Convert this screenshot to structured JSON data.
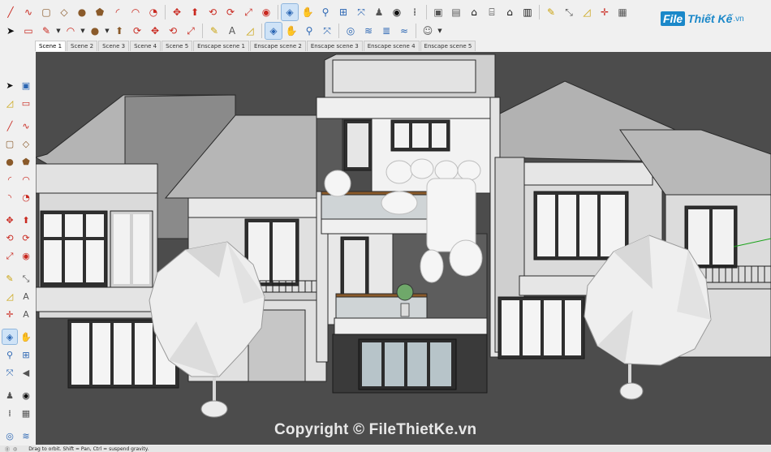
{
  "brand": {
    "badge": "File",
    "name": "Thiết Kế",
    "ext": ".vn"
  },
  "toolbar_row1": [
    {
      "name": "line-icon",
      "glyph": "╱",
      "color": "red"
    },
    {
      "name": "freehand-icon",
      "glyph": "∿",
      "color": "red"
    },
    {
      "name": "rectangle-icon",
      "glyph": "▢",
      "color": "brown"
    },
    {
      "name": "rotated-rectangle-icon",
      "glyph": "◇",
      "color": "brown"
    },
    {
      "name": "circle-icon",
      "glyph": "●",
      "color": "brown"
    },
    {
      "name": "polygon-icon",
      "glyph": "⬟",
      "color": "brown"
    },
    {
      "name": "arc-icon",
      "glyph": "◜",
      "color": "red"
    },
    {
      "name": "two-point-arc-icon",
      "glyph": "◠",
      "color": "red"
    },
    {
      "name": "pie-icon",
      "glyph": "◔",
      "color": "red"
    },
    {
      "name": "sep"
    },
    {
      "name": "move-icon",
      "glyph": "✥",
      "color": "red"
    },
    {
      "name": "push-pull-icon",
      "glyph": "⬆",
      "color": "red"
    },
    {
      "name": "rotate-icon",
      "glyph": "⟲",
      "color": "red"
    },
    {
      "name": "follow-me-icon",
      "glyph": "⟳",
      "color": "red"
    },
    {
      "name": "scale-icon",
      "glyph": "⤢",
      "color": "red"
    },
    {
      "name": "offset-icon",
      "glyph": "◉",
      "color": "red"
    },
    {
      "name": "sep"
    },
    {
      "name": "orbit-icon",
      "glyph": "◈",
      "color": "blue",
      "active": true
    },
    {
      "name": "pan-icon",
      "glyph": "✋",
      "color": "yellow"
    },
    {
      "name": "zoom-icon",
      "glyph": "⚲",
      "color": "blue"
    },
    {
      "name": "zoom-window-icon",
      "glyph": "⊞",
      "color": "blue"
    },
    {
      "name": "zoom-extents-icon",
      "glyph": "⤧",
      "color": "blue"
    },
    {
      "name": "position-camera-icon",
      "glyph": "♟",
      "color": "gray"
    },
    {
      "name": "look-around-icon",
      "glyph": "◉",
      "color": "black"
    },
    {
      "name": "walk-icon",
      "glyph": "⁞",
      "color": "black"
    },
    {
      "name": "sep"
    },
    {
      "name": "components-icon",
      "glyph": "▣",
      "color": "gray"
    },
    {
      "name": "materials-icon",
      "glyph": "▤",
      "color": "gray"
    },
    {
      "name": "home-icon",
      "glyph": "⌂",
      "color": "black"
    },
    {
      "name": "warehouse-icon",
      "glyph": "⌸",
      "color": "black"
    },
    {
      "name": "share-model-icon",
      "glyph": "⌂",
      "color": "black"
    },
    {
      "name": "extension-warehouse-icon",
      "glyph": "▥",
      "color": "black"
    },
    {
      "name": "sep"
    },
    {
      "name": "tape-measure-icon",
      "glyph": "✎",
      "color": "yellow"
    },
    {
      "name": "dimension-icon",
      "glyph": "⤡",
      "color": "gray"
    },
    {
      "name": "protractor-icon",
      "glyph": "◿",
      "color": "yellow"
    },
    {
      "name": "axes-icon",
      "glyph": "✛",
      "color": "red"
    },
    {
      "name": "section-plane-icon",
      "glyph": "▦",
      "color": "gray"
    }
  ],
  "toolbar_row2": [
    {
      "name": "select-icon",
      "glyph": "➤",
      "color": "black"
    },
    {
      "name": "eraser-icon",
      "glyph": "▭",
      "color": "red"
    },
    {
      "name": "pencil-icon",
      "glyph": "✎",
      "color": "red",
      "dropdown": true
    },
    {
      "name": "arc-tool-icon",
      "glyph": "◠",
      "color": "red",
      "dropdown": true
    },
    {
      "name": "shape-tool-icon",
      "glyph": "●",
      "color": "brown",
      "dropdown": true
    },
    {
      "name": "push-pull-tool-icon",
      "glyph": "⬆",
      "color": "brown"
    },
    {
      "name": "follow-tool-icon",
      "glyph": "⟳",
      "color": "red"
    },
    {
      "name": "move-tool-icon",
      "glyph": "✥",
      "color": "red"
    },
    {
      "name": "rotate-tool-icon",
      "glyph": "⟲",
      "color": "red"
    },
    {
      "name": "scale-tool-icon",
      "glyph": "⤢",
      "color": "red"
    },
    {
      "name": "sep"
    },
    {
      "name": "tape-icon",
      "glyph": "✎",
      "color": "yellow"
    },
    {
      "name": "text-icon",
      "glyph": "A",
      "color": "gray"
    },
    {
      "name": "paint-icon",
      "glyph": "◿",
      "color": "yellow"
    },
    {
      "name": "sep"
    },
    {
      "name": "orbit-tool-icon",
      "glyph": "◈",
      "color": "blue",
      "active": true
    },
    {
      "name": "pan-tool-icon",
      "glyph": "✋",
      "color": "yellow"
    },
    {
      "name": "zoom-tool-icon",
      "glyph": "⚲",
      "color": "blue"
    },
    {
      "name": "zoom-extents-tool-icon",
      "glyph": "⤧",
      "color": "blue"
    },
    {
      "name": "sep"
    },
    {
      "name": "sandbox-icon",
      "glyph": "◎",
      "color": "blue"
    },
    {
      "name": "smoove-icon",
      "glyph": "≋",
      "color": "blue"
    },
    {
      "name": "stamp-icon",
      "glyph": "≣",
      "color": "blue"
    },
    {
      "name": "drape-icon",
      "glyph": "≈",
      "color": "blue"
    },
    {
      "name": "sep"
    },
    {
      "name": "account-icon",
      "glyph": "☺",
      "color": "gray",
      "dropdown": true
    }
  ],
  "scenes": [
    {
      "label": "Scene 1",
      "active": true
    },
    {
      "label": "Scene 2"
    },
    {
      "label": "Scene 3"
    },
    {
      "label": "Scene 4"
    },
    {
      "label": "Scene 5"
    },
    {
      "label": "Enscape scene 1"
    },
    {
      "label": "Enscape scene 2"
    },
    {
      "label": "Enscape scene 3"
    },
    {
      "label": "Enscape scene 4"
    },
    {
      "label": "Enscape scene 5"
    }
  ],
  "left_toolbar": [
    [
      {
        "name": "select-icon",
        "glyph": "➤",
        "color": "black"
      },
      {
        "name": "components-icon",
        "glyph": "▣",
        "color": "blue"
      }
    ],
    [
      {
        "name": "paint-bucket-icon",
        "glyph": "◿",
        "color": "yellow"
      },
      {
        "name": "eraser-icon",
        "glyph": "▭",
        "color": "red"
      }
    ],
    "gap",
    [
      {
        "name": "line-icon",
        "glyph": "╱",
        "color": "red"
      },
      {
        "name": "freehand-icon",
        "glyph": "∿",
        "color": "red"
      }
    ],
    [
      {
        "name": "rectangle-icon",
        "glyph": "▢",
        "color": "brown"
      },
      {
        "name": "rotated-rectangle-icon",
        "glyph": "◇",
        "color": "brown"
      }
    ],
    [
      {
        "name": "circle-icon",
        "glyph": "●",
        "color": "brown"
      },
      {
        "name": "polygon-icon",
        "glyph": "⬟",
        "color": "brown"
      }
    ],
    [
      {
        "name": "arc-icon",
        "glyph": "◜",
        "color": "red"
      },
      {
        "name": "two-point-arc-icon",
        "glyph": "◠",
        "color": "red"
      }
    ],
    [
      {
        "name": "three-point-arc-icon",
        "glyph": "◝",
        "color": "red"
      },
      {
        "name": "pie-icon",
        "glyph": "◔",
        "color": "red"
      }
    ],
    "gap",
    [
      {
        "name": "move-icon",
        "glyph": "✥",
        "color": "red"
      },
      {
        "name": "push-pull-icon",
        "glyph": "⬆",
        "color": "red"
      }
    ],
    [
      {
        "name": "rotate-icon",
        "glyph": "⟲",
        "color": "red"
      },
      {
        "name": "follow-me-icon",
        "glyph": "⟳",
        "color": "red"
      }
    ],
    [
      {
        "name": "scale-icon",
        "glyph": "⤢",
        "color": "red"
      },
      {
        "name": "offset-icon",
        "glyph": "◉",
        "color": "red"
      }
    ],
    "gap",
    [
      {
        "name": "tape-measure-icon",
        "glyph": "✎",
        "color": "yellow"
      },
      {
        "name": "dimension-icon",
        "glyph": "⤡",
        "color": "gray"
      }
    ],
    [
      {
        "name": "protractor-icon",
        "glyph": "◿",
        "color": "yellow"
      },
      {
        "name": "text-icon",
        "glyph": "A",
        "color": "gray"
      }
    ],
    [
      {
        "name": "axes-icon",
        "glyph": "✛",
        "color": "red"
      },
      {
        "name": "3d-text-icon",
        "glyph": "A",
        "color": "gray"
      }
    ],
    "gap",
    [
      {
        "name": "orbit-icon",
        "glyph": "◈",
        "color": "blue",
        "active": true
      },
      {
        "name": "pan-icon",
        "glyph": "✋",
        "color": "yellow"
      }
    ],
    [
      {
        "name": "zoom-icon",
        "glyph": "⚲",
        "color": "blue"
      },
      {
        "name": "zoom-window-icon",
        "glyph": "⊞",
        "color": "blue"
      }
    ],
    [
      {
        "name": "zoom-extents-icon",
        "glyph": "⤧",
        "color": "blue"
      },
      {
        "name": "previous-view-icon",
        "glyph": "◀",
        "color": "gray"
      }
    ],
    "gap",
    [
      {
        "name": "position-camera-icon",
        "glyph": "♟",
        "color": "gray"
      },
      {
        "name": "look-around-icon",
        "glyph": "◉",
        "color": "black"
      }
    ],
    [
      {
        "name": "walk-icon",
        "glyph": "⁞",
        "color": "black"
      },
      {
        "name": "section-plane-icon",
        "glyph": "▦",
        "color": "gray"
      }
    ],
    "gap",
    [
      {
        "name": "sandbox-from-contours-icon",
        "glyph": "◎",
        "color": "blue"
      },
      {
        "name": "sandbox-scratch-icon",
        "glyph": "≋",
        "color": "blue"
      }
    ],
    [
      {
        "name": "smoove-icon",
        "glyph": "≣",
        "color": "blue"
      },
      {
        "name": "stamp-icon",
        "glyph": "≈",
        "color": "blue"
      }
    ]
  ],
  "status": {
    "text": "Drag to orbit. Shift = Pan, Ctrl = suspend gravity."
  },
  "watermark": "Copyright © FileThietKe.vn"
}
